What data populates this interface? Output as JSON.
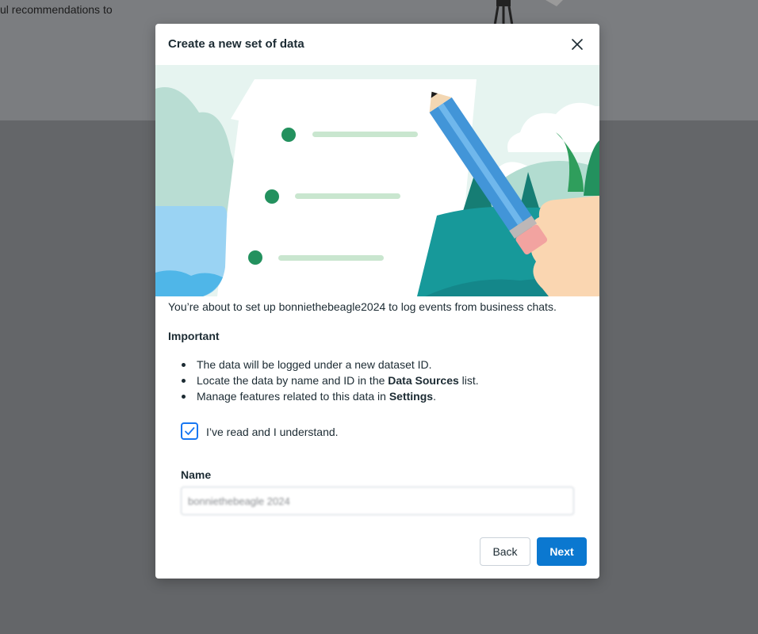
{
  "background": {
    "partial_text": "ul recommendations to"
  },
  "modal": {
    "title": "Create a new set of data",
    "intro": "You’re about to set up bonniethebeagle2024 to log events from business chats.",
    "important_heading": "Important",
    "bullets": {
      "b1": "The data will be logged under a new dataset ID.",
      "b2_pre": "Locate the data by name and ID in the ",
      "b2_bold": "Data Sources",
      "b2_post": " list.",
      "b3_pre": "Manage features related to this data in ",
      "b3_bold": "Settings",
      "b3_post": "."
    },
    "checkbox": {
      "label": "I’ve read and I understand.",
      "checked": true
    },
    "name_field": {
      "label": "Name",
      "value": "bonniethebeagle 2024"
    },
    "buttons": {
      "back": "Back",
      "next": "Next"
    }
  },
  "colors": {
    "primary": "#0b78d0",
    "checkbox_border": "#1877f2",
    "illustration_green": "#23915e"
  },
  "icons": {
    "close": "close-icon",
    "check": "checkmark-icon"
  }
}
